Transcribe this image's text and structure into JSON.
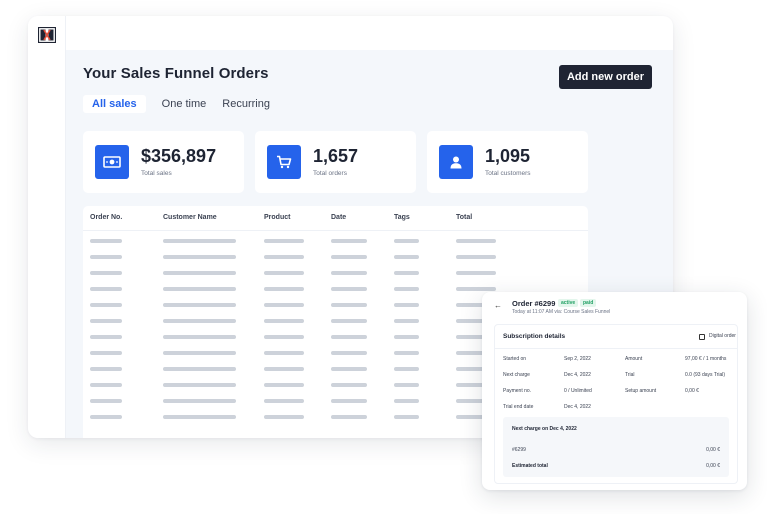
{
  "app": {
    "logo": "clickfunnels-logo"
  },
  "page": {
    "title": "Your Sales Funnel Orders",
    "add_button": "Add new order"
  },
  "tabs": [
    {
      "label": "All sales",
      "active": true
    },
    {
      "label": "One time",
      "active": false
    },
    {
      "label": "Recurring",
      "active": false
    }
  ],
  "stats": [
    {
      "value": "$356,897",
      "label": "Total sales",
      "icon": "money-icon"
    },
    {
      "value": "1,657",
      "label": "Total orders",
      "icon": "cart-icon"
    },
    {
      "value": "1,095",
      "label": "Total customers",
      "icon": "user-icon"
    }
  ],
  "table": {
    "columns": [
      "Order No.",
      "Customer Name",
      "Product",
      "Date",
      "Tags",
      "Total"
    ],
    "placeholder_rows": 12
  },
  "order_detail": {
    "title": "Order #6299",
    "badges": [
      "active",
      "paid"
    ],
    "subtitle": "Today at 11:07 AM via: Course Sales Funnel",
    "section_title": "Subscription details",
    "digital_order_label": "Digital order",
    "fields_left": [
      {
        "label": "Started on",
        "value": "Sep 2, 2022"
      },
      {
        "label": "Next charge",
        "value": "Dec 4, 2022"
      },
      {
        "label": "Payment no.",
        "value": "0 / Unlimited"
      },
      {
        "label": "Trial end date",
        "value": "Dec 4, 2022"
      }
    ],
    "fields_right": [
      {
        "label": "Amount",
        "value": "97,00 € / 1 months"
      },
      {
        "label": "Trial",
        "value": "0.0 (93 days Trial)"
      },
      {
        "label": "Setup amount",
        "value": "0,00 €"
      }
    ],
    "next_charge": {
      "heading": "Next charge on Dec 4, 2022",
      "item_label": "#6299",
      "item_value": "0,00 €",
      "total_label": "Estimated total",
      "total_value": "0,00 €"
    }
  },
  "colors": {
    "accent": "#2563eb",
    "button_dark": "#1f2433",
    "placeholder": "#cdd2da",
    "success": "#21a064"
  }
}
